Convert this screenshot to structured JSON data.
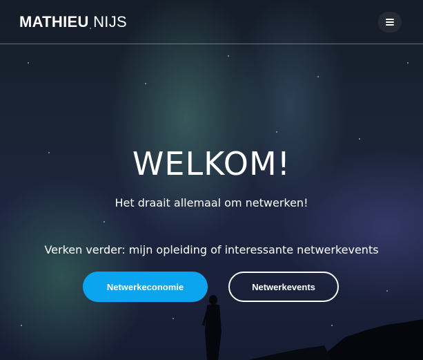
{
  "brand": {
    "bold": "MATHIEU",
    "light": "NIJS"
  },
  "nav": {
    "menu_icon": "bars-icon"
  },
  "hero": {
    "title": "WELKOM!",
    "subtitle": "Het draait allemaal om netwerken!",
    "explore_text": "Verken verder: mijn opleiding of interessante netwerkevents",
    "buttons": {
      "primary_label": "Netwerkeconomie",
      "secondary_label": "Netwerkevents"
    }
  },
  "colors": {
    "accent": "#0aa5ee",
    "background": "#1a2433",
    "text": "#ffffff"
  }
}
